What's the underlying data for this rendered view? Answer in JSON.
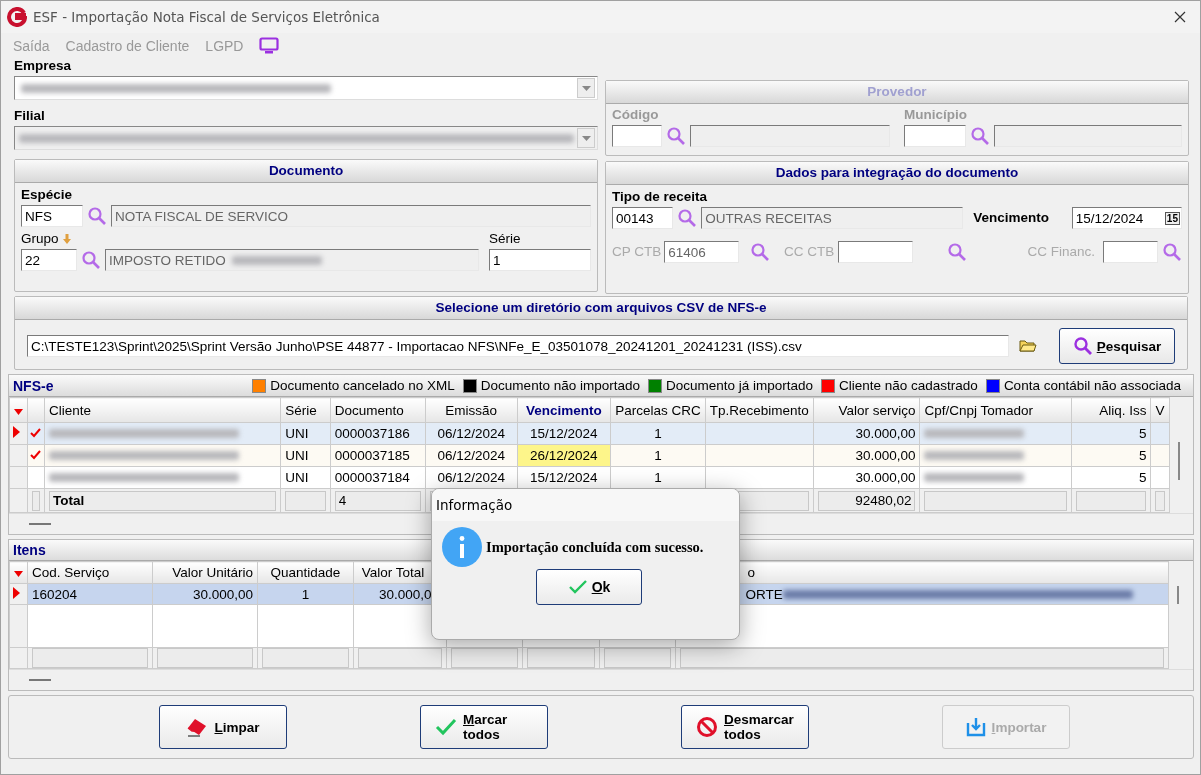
{
  "window": {
    "title": "ESF - Importação Nota Fiscal de Serviços Eletrônica"
  },
  "menu": [
    {
      "label": "Saída"
    },
    {
      "label": "Cadastro de Cliente"
    },
    {
      "label": "LGPD"
    }
  ],
  "empresa": {
    "label": "Empresa"
  },
  "filial": {
    "label": "Filial"
  },
  "provedor": {
    "title": "Provedor",
    "disabled": true,
    "fields": [
      {
        "label": "Código"
      },
      {
        "label": "Município"
      }
    ]
  },
  "documento": {
    "title": "Documento",
    "especie": {
      "label": "Espécie",
      "code": "NFS",
      "description": "NOTA FISCAL DE SERVICO"
    },
    "grupo": {
      "label": "Grupo",
      "code": "22",
      "description": "IMPOSTO RETIDO"
    },
    "serie": {
      "label": "Série",
      "value": "1"
    }
  },
  "integracao": {
    "title": "Dados para integração do documento",
    "tipo": {
      "label": "Tipo de receita",
      "code": "00143",
      "description": "OUTRAS RECEITAS"
    },
    "vencimento": {
      "label": "Vencimento",
      "value": "15/12/2024",
      "calendar_day": "15"
    },
    "accounts": [
      {
        "label": "CP CTB",
        "value": "61406",
        "disabled": true
      },
      {
        "label": "CC CTB",
        "disabled": true
      },
      {
        "label": "CC Financ.",
        "disabled": true
      }
    ]
  },
  "directory": {
    "title": "Selecione um diretório com arquivos CSV de NFS-e",
    "path": "C:\\TESTE123\\Sprint\\2025\\Sprint Versão Junho\\PSE 44877 - Importacao NFS\\NFe_E_03501078_20241201_20241231 (ISS).csv",
    "search_button": {
      "label": "Pesquisar"
    }
  },
  "nfse": {
    "title": "NFS-e",
    "legend": [
      {
        "label": "Documento cancelado no XML",
        "color": "#ff8000"
      },
      {
        "label": "Documento não importado",
        "color": "#000000"
      },
      {
        "label": "Documento já importado",
        "color": "#008000"
      },
      {
        "label": "Cliente não cadastrado",
        "color": "#ff0000"
      },
      {
        "label": "Conta contábil não associada",
        "color": "#0000ff"
      }
    ],
    "columns": [
      {
        "label": "Cliente",
        "sorted": false
      },
      {
        "label": "Série",
        "sorted": false
      },
      {
        "label": "Documento",
        "sorted": false
      },
      {
        "label": "Emissão",
        "sorted": false
      },
      {
        "label": "Vencimento",
        "sorted": true
      },
      {
        "label": "Parcelas CRC",
        "sorted": false
      },
      {
        "label": "Tp.Recebimento",
        "sorted": false
      },
      {
        "label": "Valor serviço",
        "sorted": false
      },
      {
        "label": "Cpf/Cnpj Tomador",
        "sorted": false
      },
      {
        "label": "Aliq. Iss",
        "sorted": false
      },
      {
        "label": "V",
        "sorted": false
      }
    ],
    "rows": [
      {
        "current": true,
        "checked": true,
        "selected": true,
        "due_highlight": false,
        "serie": "UNI",
        "documento": "0000037186",
        "emissao": "06/12/2024",
        "vencimento": "15/12/2024",
        "parcelas": "1",
        "valor": "30.000,00",
        "aliq": "5"
      },
      {
        "current": false,
        "checked": true,
        "selected": false,
        "due_highlight": true,
        "serie": "UNI",
        "documento": "0000037185",
        "emissao": "06/12/2024",
        "vencimento": "26/12/2024",
        "parcelas": "1",
        "valor": "30.000,00",
        "aliq": "5"
      },
      {
        "current": false,
        "checked": false,
        "selected": false,
        "due_highlight": false,
        "serie": "UNI",
        "documento": "0000037184",
        "emissao": "06/12/2024",
        "vencimento": "15/12/2024",
        "parcelas": "1",
        "valor": "30.000,00",
        "aliq": "5"
      }
    ],
    "total": {
      "label": "Total",
      "documento": "4",
      "valor": "92480,02"
    }
  },
  "itens": {
    "title": "Itens",
    "columns": [
      "Cod. Serviço",
      "Valor Unitário",
      "Quantidade",
      "Valor Total",
      "o"
    ],
    "rows": [
      {
        "current": true,
        "selected": true,
        "cells": [
          "160204",
          "30.000,00",
          "1",
          "30.000,0",
          "ORTE"
        ]
      }
    ]
  },
  "dialog": {
    "title": "Informação",
    "message": "Importação concluída com sucesso.",
    "button": {
      "label": "Ok"
    }
  },
  "buttons": [
    {
      "kind": "clear",
      "label": "Limpar",
      "disabled": false
    },
    {
      "kind": "mark",
      "label": "Marcar todos",
      "disabled": false
    },
    {
      "kind": "unmark",
      "label": "Desmarcar todos",
      "disabled": false
    },
    {
      "kind": "import",
      "label": "Importar",
      "disabled": true
    }
  ]
}
